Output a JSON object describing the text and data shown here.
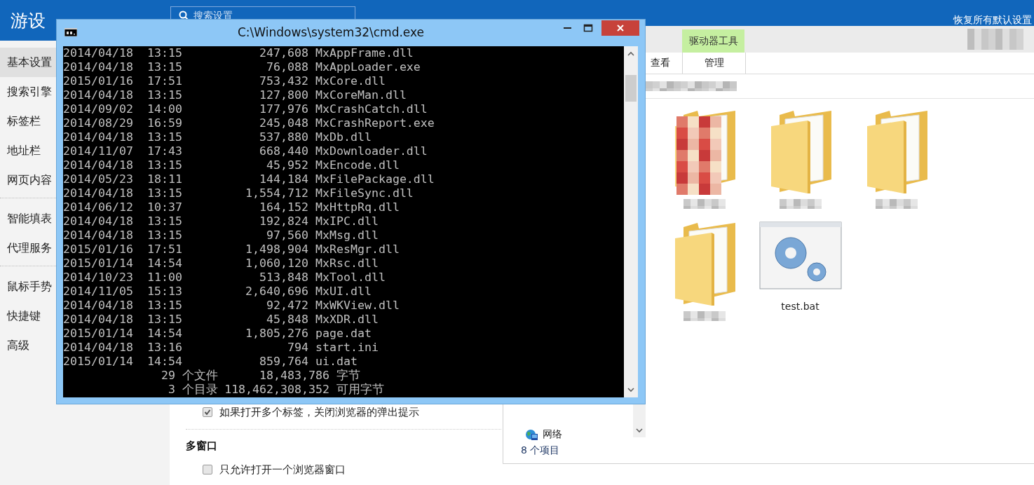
{
  "settings": {
    "title": "游设",
    "search": {
      "placeholder": "搜索设置"
    },
    "reset_link": "恢复所有默认设置",
    "sidebar": {
      "groups": [
        [
          {
            "label": "基本设置",
            "selected": true
          },
          {
            "label": "搜索引擎",
            "selected": false
          },
          {
            "label": "标签栏",
            "selected": false
          },
          {
            "label": "地址栏",
            "selected": false
          },
          {
            "label": "网页内容",
            "selected": false
          }
        ],
        [
          {
            "label": "智能填表",
            "selected": false
          },
          {
            "label": "代理服务",
            "selected": false
          }
        ],
        [
          {
            "label": "鼠标手势",
            "selected": false
          },
          {
            "label": "快捷键",
            "selected": false
          },
          {
            "label": "高级",
            "selected": false
          }
        ]
      ]
    },
    "content": [
      {
        "kind": "checkbox",
        "label": "如果打开多个标签，关闭浏览器的弹出提示",
        "checked": true
      },
      {
        "kind": "divider"
      },
      {
        "kind": "heading",
        "label": "多窗口"
      },
      {
        "kind": "checkbox",
        "label": "只允许打开一个浏览器窗口",
        "checked": false
      }
    ]
  },
  "explorer": {
    "ribbon": {
      "context_tab": "驱动器工具",
      "tabs": [
        {
          "label": "查看",
          "selected": false
        },
        {
          "label": "管理",
          "selected": true
        }
      ]
    },
    "nav": [
      {
        "label": "网络"
      }
    ],
    "files": [
      {
        "kind": "blurred_folder"
      },
      {
        "kind": "folder"
      },
      {
        "kind": "folder"
      },
      {
        "kind": "folder"
      },
      {
        "kind": "batch",
        "name": "test.bat"
      }
    ],
    "status": "8 个项目"
  },
  "cmd": {
    "title": "C:\\Windows\\system32\\cmd.exe",
    "rows": [
      {
        "date": "2014/04/18",
        "time": "13:15",
        "size": "247,608",
        "name": "MxAppFrame.dll"
      },
      {
        "date": "2014/04/18",
        "time": "13:15",
        "size": "76,088",
        "name": "MxAppLoader.exe"
      },
      {
        "date": "2015/01/16",
        "time": "17:51",
        "size": "753,432",
        "name": "MxCore.dll"
      },
      {
        "date": "2014/04/18",
        "time": "13:15",
        "size": "127,800",
        "name": "MxCoreMan.dll"
      },
      {
        "date": "2014/09/02",
        "time": "14:00",
        "size": "177,976",
        "name": "MxCrashCatch.dll"
      },
      {
        "date": "2014/08/29",
        "time": "16:59",
        "size": "245,048",
        "name": "MxCrashReport.exe"
      },
      {
        "date": "2014/04/18",
        "time": "13:15",
        "size": "537,880",
        "name": "MxDb.dll"
      },
      {
        "date": "2014/11/07",
        "time": "17:43",
        "size": "668,440",
        "name": "MxDownloader.dll"
      },
      {
        "date": "2014/04/18",
        "time": "13:15",
        "size": "45,952",
        "name": "MxEncode.dll"
      },
      {
        "date": "2014/05/23",
        "time": "18:11",
        "size": "144,184",
        "name": "MxFilePackage.dll"
      },
      {
        "date": "2014/04/18",
        "time": "13:15",
        "size": "1,554,712",
        "name": "MxFileSync.dll"
      },
      {
        "date": "2014/06/12",
        "time": "10:37",
        "size": "164,152",
        "name": "MxHttpRq.dll"
      },
      {
        "date": "2014/04/18",
        "time": "13:15",
        "size": "192,824",
        "name": "MxIPC.dll"
      },
      {
        "date": "2014/04/18",
        "time": "13:15",
        "size": "97,560",
        "name": "MxMsg.dll"
      },
      {
        "date": "2015/01/16",
        "time": "17:51",
        "size": "1,498,904",
        "name": "MxResMgr.dll"
      },
      {
        "date": "2015/01/14",
        "time": "14:54",
        "size": "1,060,120",
        "name": "MxRsc.dll"
      },
      {
        "date": "2014/10/23",
        "time": "11:00",
        "size": "513,848",
        "name": "MxTool.dll"
      },
      {
        "date": "2014/11/05",
        "time": "15:13",
        "size": "2,640,696",
        "name": "MxUI.dll"
      },
      {
        "date": "2014/04/18",
        "time": "13:15",
        "size": "92,472",
        "name": "MxWKView.dll"
      },
      {
        "date": "2014/04/18",
        "time": "13:15",
        "size": "45,848",
        "name": "MxXDR.dll"
      },
      {
        "date": "2015/01/14",
        "time": "14:54",
        "size": "1,805,276",
        "name": "page.dat"
      },
      {
        "date": "2014/04/18",
        "time": "13:16",
        "size": "794",
        "name": "start.ini"
      },
      {
        "date": "2015/01/14",
        "time": "14:54",
        "size": "859,764",
        "name": "ui.dat"
      }
    ],
    "summary": [
      {
        "count": "29",
        "label": "个文件",
        "size": "18,483,786",
        "unit": "字节"
      },
      {
        "count": "3",
        "label": "个目录",
        "size": "118,462,308,352",
        "unit": "可用字节"
      }
    ]
  }
}
